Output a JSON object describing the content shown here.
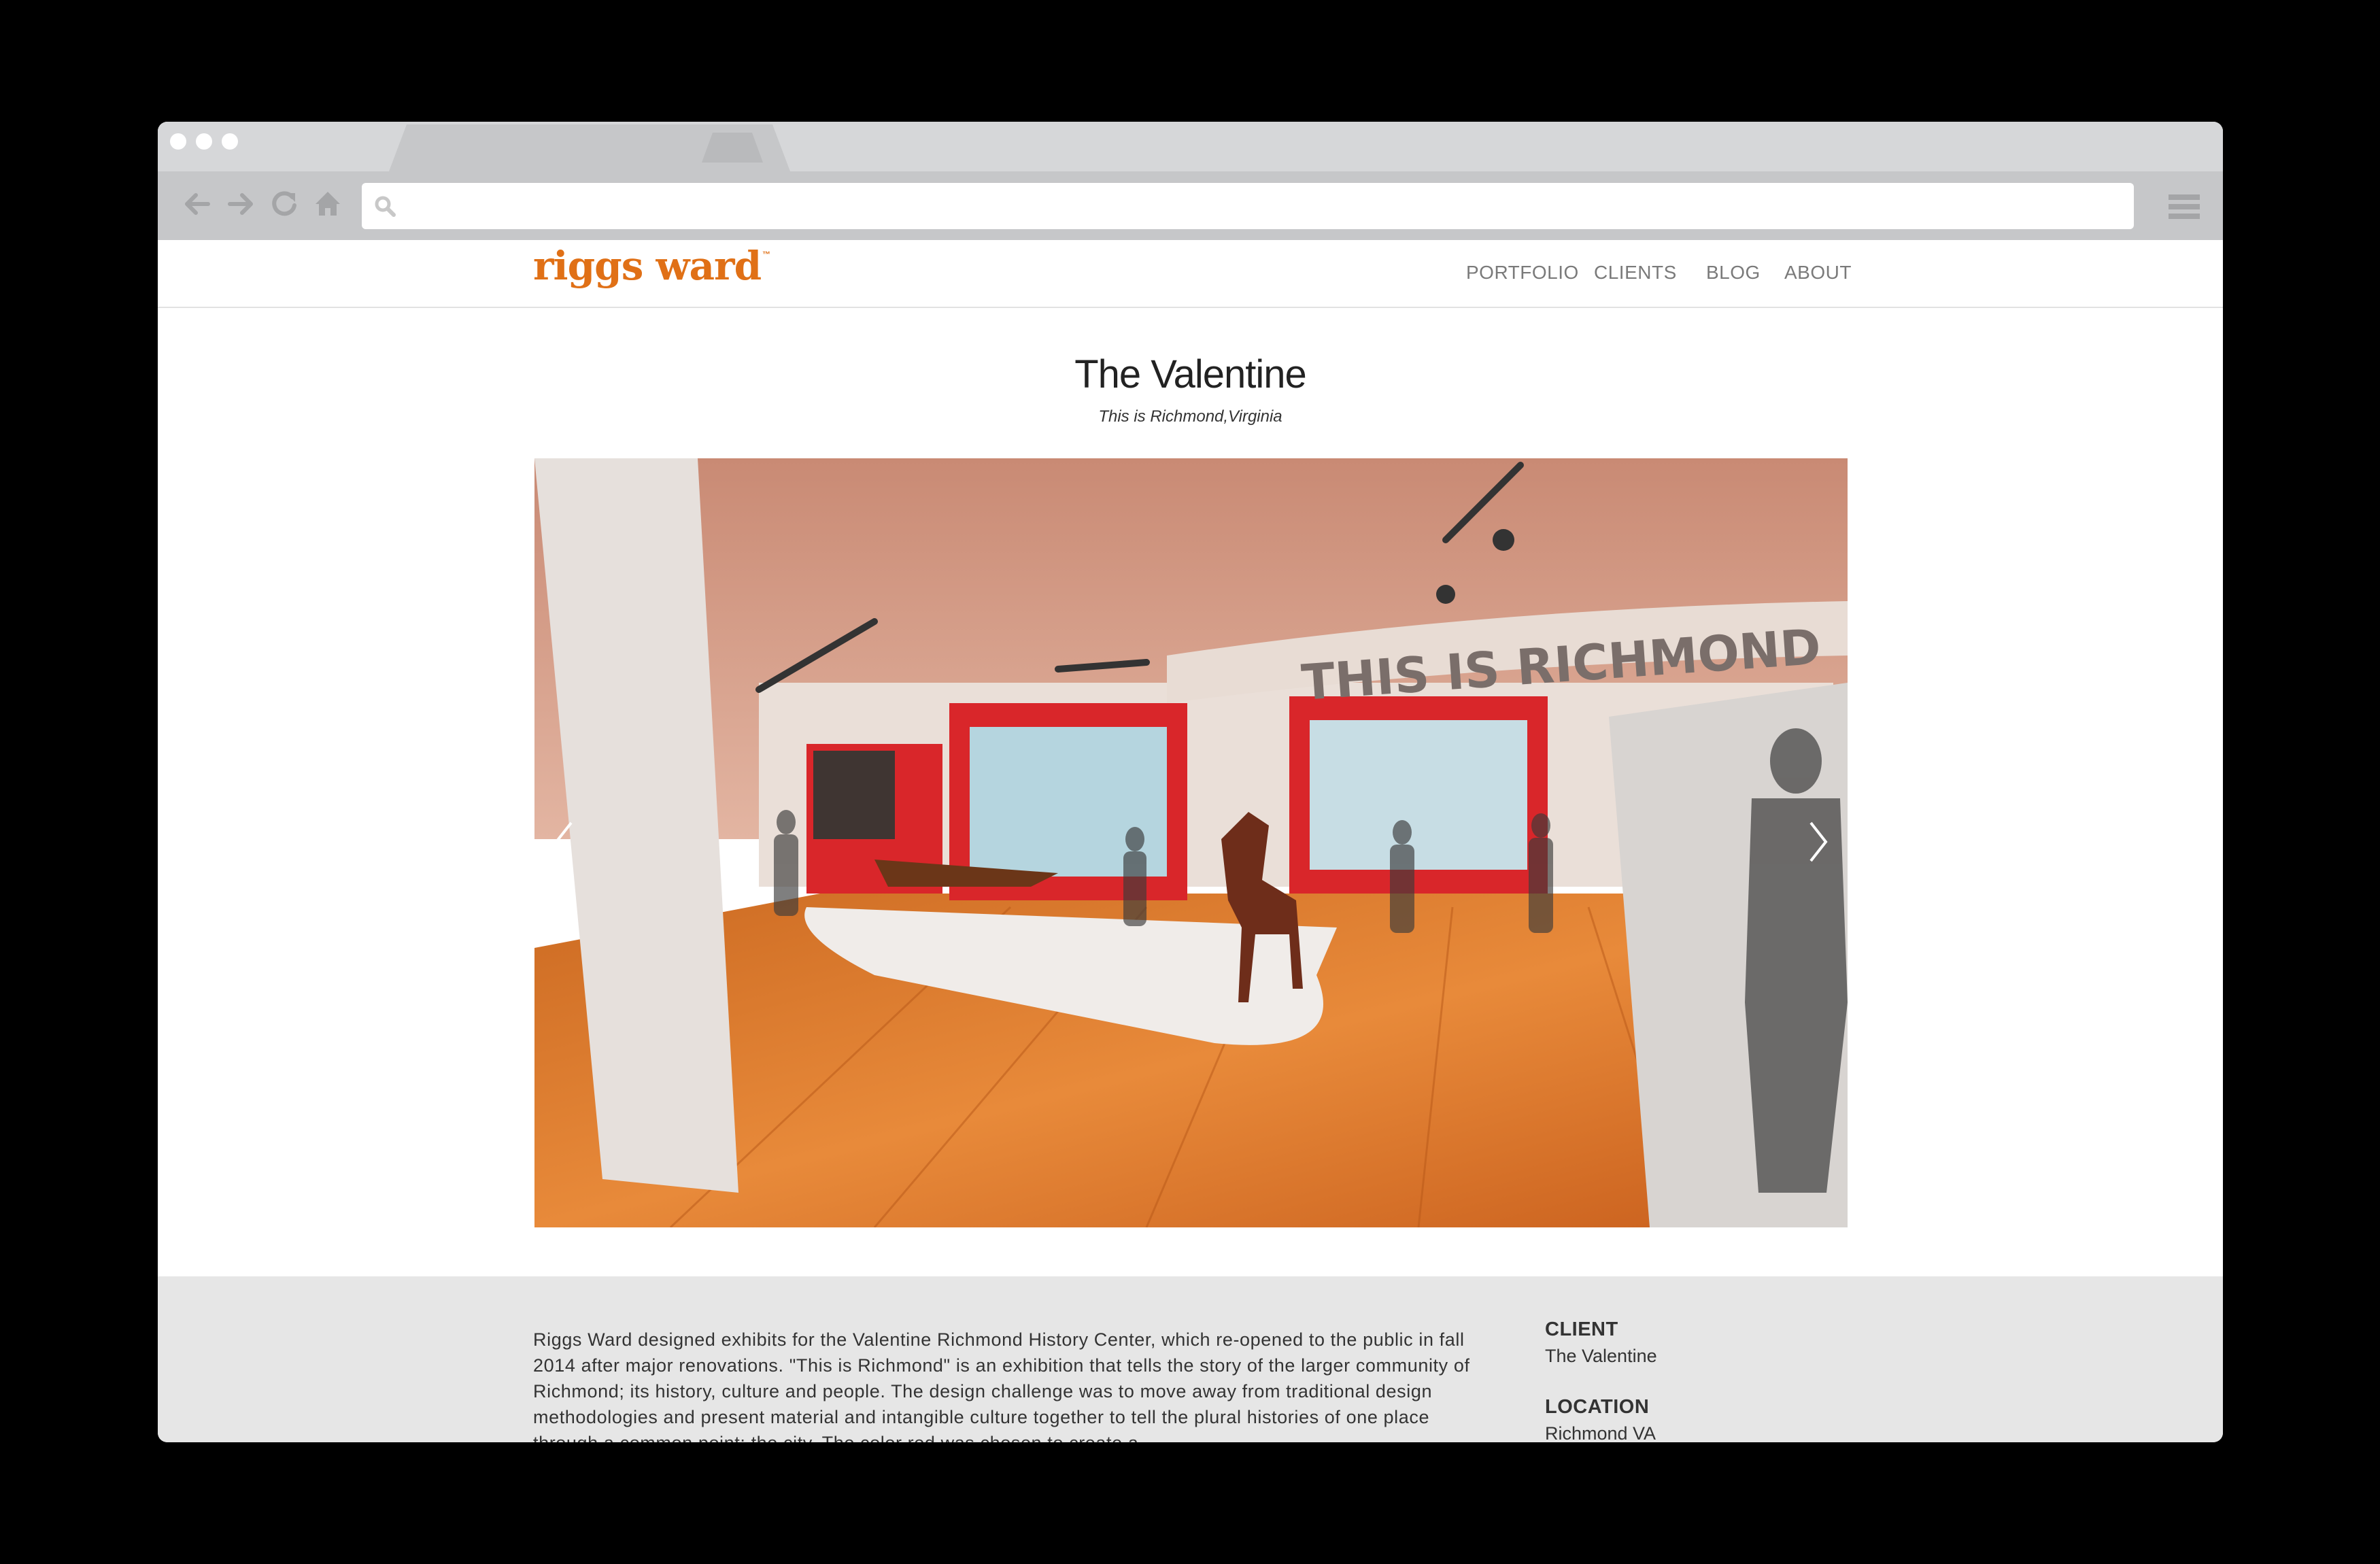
{
  "browser": {
    "tab_close_glyph": "×"
  },
  "site": {
    "logo": "riggs ward",
    "logo_mark": "™",
    "nav": [
      "PORTFOLIO",
      "CLIENTS",
      "BLOG",
      "ABOUT"
    ],
    "accent_color": "#e07016"
  },
  "project": {
    "title": "The Valentine",
    "subtitle": "This is Richmond,Virginia",
    "image_sign_text": "THIS IS RICHMOND",
    "description": "Riggs Ward designed exhibits for the Valentine Richmond History Center, which re-opened to the public in fall 2014 after major renovations. \"This is Richmond\" is an exhibition that tells the story of the larger community of Richmond; its history, culture and people. The design challenge was to move away from traditional design methodologies and present material and intangible culture together to tell the plural histories of one place through a common point: the city. The color red was chosen to create a",
    "client_label": "CLIENT",
    "client_value": "The Valentine",
    "location_label": "LOCATION",
    "location_value": "Richmond VA"
  },
  "icons": {
    "back": "arrow-left",
    "forward": "arrow-right",
    "reload": "reload",
    "home": "home",
    "search": "magnifier",
    "menu": "hamburger",
    "prev": "chevron-left",
    "next": "chevron-right"
  }
}
